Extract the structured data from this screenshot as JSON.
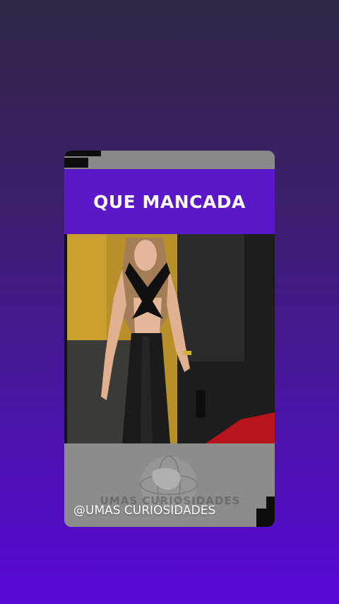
{
  "story": {
    "title": "QUE MANCADA",
    "handle": "@UMAS CURIOSIDADES",
    "watermark_text": "UMAS CURIOSIDADES"
  },
  "colors": {
    "bg_top": "#2f2645",
    "bg_bottom": "#5a08d8",
    "title_band": "#5a18c8",
    "card_gray": "#8a8a8a"
  },
  "icons": {
    "watermark": "globe-logo-icon"
  }
}
